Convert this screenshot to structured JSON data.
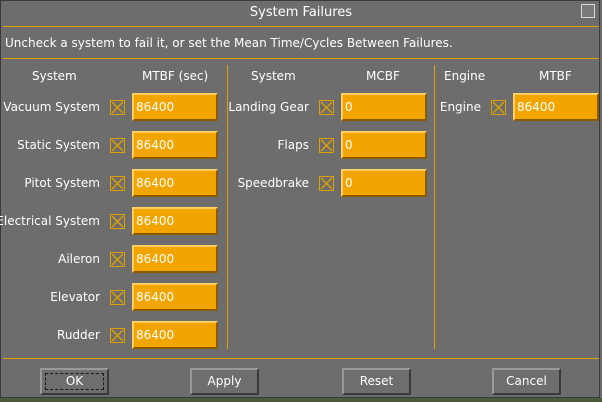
{
  "dialog": {
    "title": "System Failures",
    "instructions": "Uncheck a system to fail it, or set the Mean Time/Cycles Between Failures."
  },
  "columns": {
    "systems": {
      "name_header": "System",
      "value_header": "MTBF (sec)"
    },
    "gear": {
      "name_header": "System",
      "value_header": "MCBF"
    },
    "engine": {
      "name_header": "Engine",
      "value_header": "MTBF"
    }
  },
  "systems": [
    {
      "label": "Vacuum System",
      "value": "86400",
      "checked": true
    },
    {
      "label": "Static System",
      "value": "86400",
      "checked": true
    },
    {
      "label": "Pitot System",
      "value": "86400",
      "checked": true
    },
    {
      "label": "Electrical System",
      "value": "86400",
      "checked": true
    },
    {
      "label": "Aileron",
      "value": "86400",
      "checked": true
    },
    {
      "label": "Elevator",
      "value": "86400",
      "checked": true
    },
    {
      "label": "Rudder",
      "value": "86400",
      "checked": true
    }
  ],
  "gear": [
    {
      "label": "Landing Gear",
      "value": "0",
      "checked": true
    },
    {
      "label": "Flaps",
      "value": "0",
      "checked": true
    },
    {
      "label": "Speedbrake",
      "value": "0",
      "checked": true
    }
  ],
  "engine": [
    {
      "label": "Engine",
      "value": "86400",
      "checked": true
    }
  ],
  "buttons": {
    "ok": "OK",
    "apply": "Apply",
    "reset": "Reset",
    "cancel": "Cancel"
  },
  "colors": {
    "accent": "#e0a000",
    "field": "#f2a400",
    "background": "#6d6d6d"
  }
}
